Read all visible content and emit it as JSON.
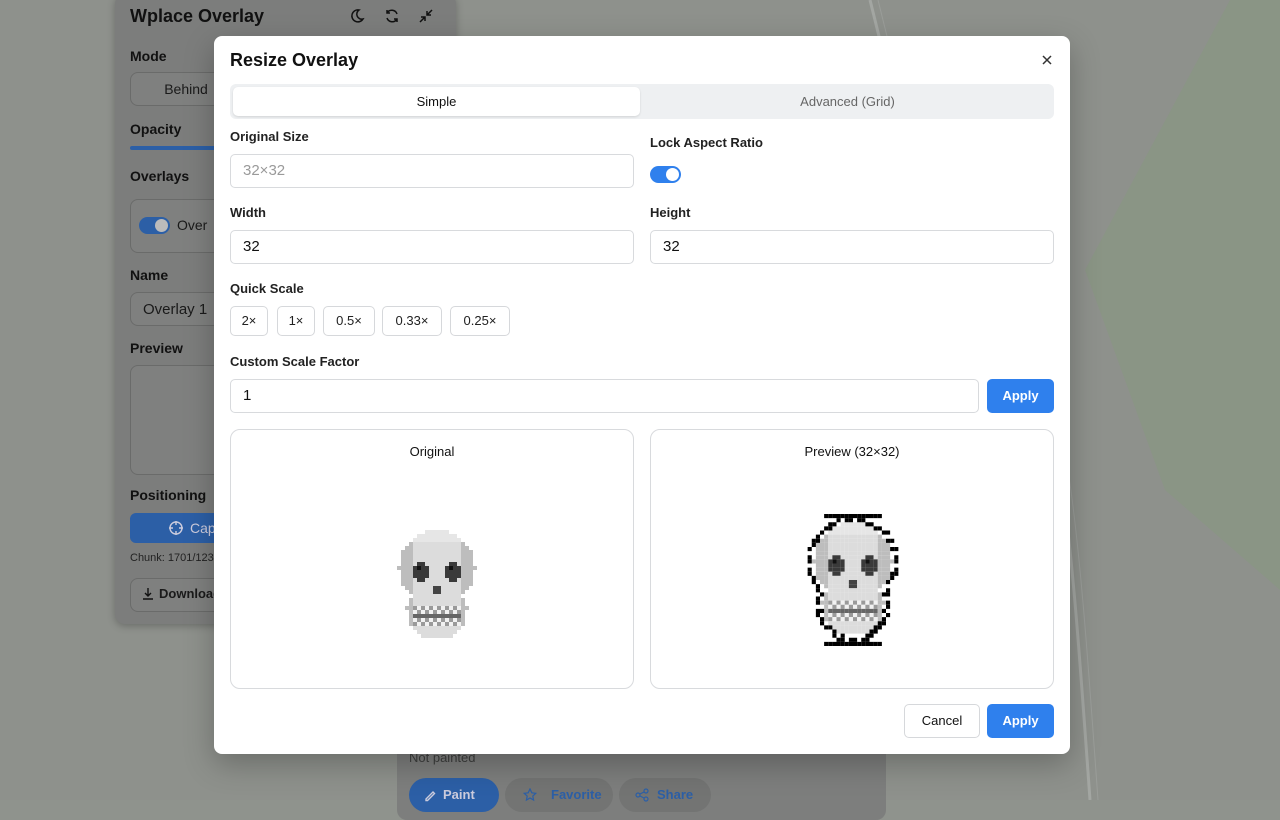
{
  "background_panel": {
    "title": "Wplace Overlay",
    "mode_label": "Mode",
    "mode_value": "Behind",
    "opacity_label": "Opacity",
    "overlays_label": "Overlays",
    "overlay_item": "Over",
    "name_label": "Name",
    "name_value": "Overlay 1",
    "preview_label": "Preview",
    "positioning_label": "Positioning",
    "capture_label": "Cap",
    "chunk_text": "Chunk: 1701/123",
    "download_label": "Download"
  },
  "bottom_card": {
    "status": "Not painted",
    "paint": "Paint",
    "favorite": "Favorite",
    "share": "Share"
  },
  "modal": {
    "title": "Resize Overlay",
    "tabs": [
      {
        "label": "Simple",
        "active": true
      },
      {
        "label": "Advanced (Grid)",
        "active": false
      }
    ],
    "original_size_label": "Original Size",
    "original_size_value": "32×32",
    "lock_aspect_label": "Lock Aspect Ratio",
    "lock_aspect_on": true,
    "width_label": "Width",
    "width_value": "32",
    "height_label": "Height",
    "height_value": "32",
    "quick_scale_label": "Quick Scale",
    "quick_scales": [
      "2×",
      "1×",
      "0.5×",
      "0.33×",
      "0.25×"
    ],
    "custom_scale_label": "Custom Scale Factor",
    "custom_scale_value": "1",
    "apply_scale": "Apply",
    "original_label": "Original",
    "preview_label": "Preview (32×32)",
    "cancel": "Cancel",
    "apply": "Apply"
  },
  "colors": {
    "accent": "#2f80ed",
    "border": "#d8dadd"
  }
}
